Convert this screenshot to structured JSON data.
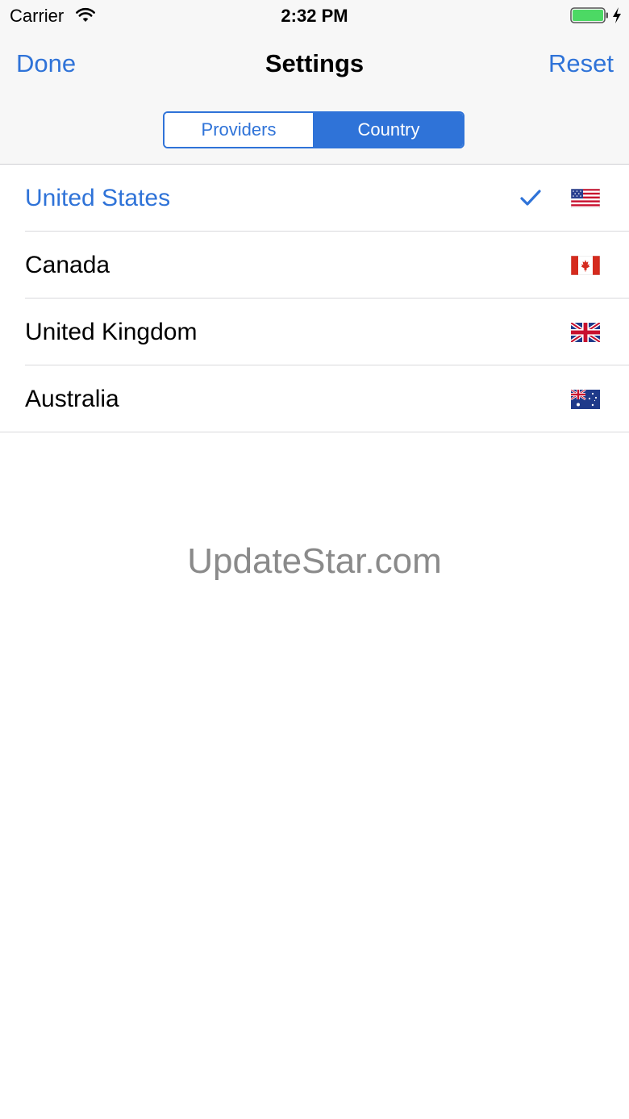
{
  "status_bar": {
    "carrier": "Carrier",
    "time": "2:32 PM"
  },
  "nav": {
    "left_button": "Done",
    "title": "Settings",
    "right_button": "Reset"
  },
  "segmented": {
    "options": [
      "Providers",
      "Country"
    ],
    "selected": "Country"
  },
  "countries": [
    {
      "label": "United States",
      "flag": "us-flag-icon",
      "selected": true
    },
    {
      "label": "Canada",
      "flag": "ca-flag-icon",
      "selected": false
    },
    {
      "label": "United Kingdom",
      "flag": "uk-flag-icon",
      "selected": false
    },
    {
      "label": "Australia",
      "flag": "au-flag-icon",
      "selected": false
    }
  ],
  "watermark": "UpdateStar.com",
  "colors": {
    "accent": "#2f73d8",
    "bar_background": "#f7f7f7",
    "battery": "#4cd964",
    "watermark": "#8a8a8a"
  }
}
